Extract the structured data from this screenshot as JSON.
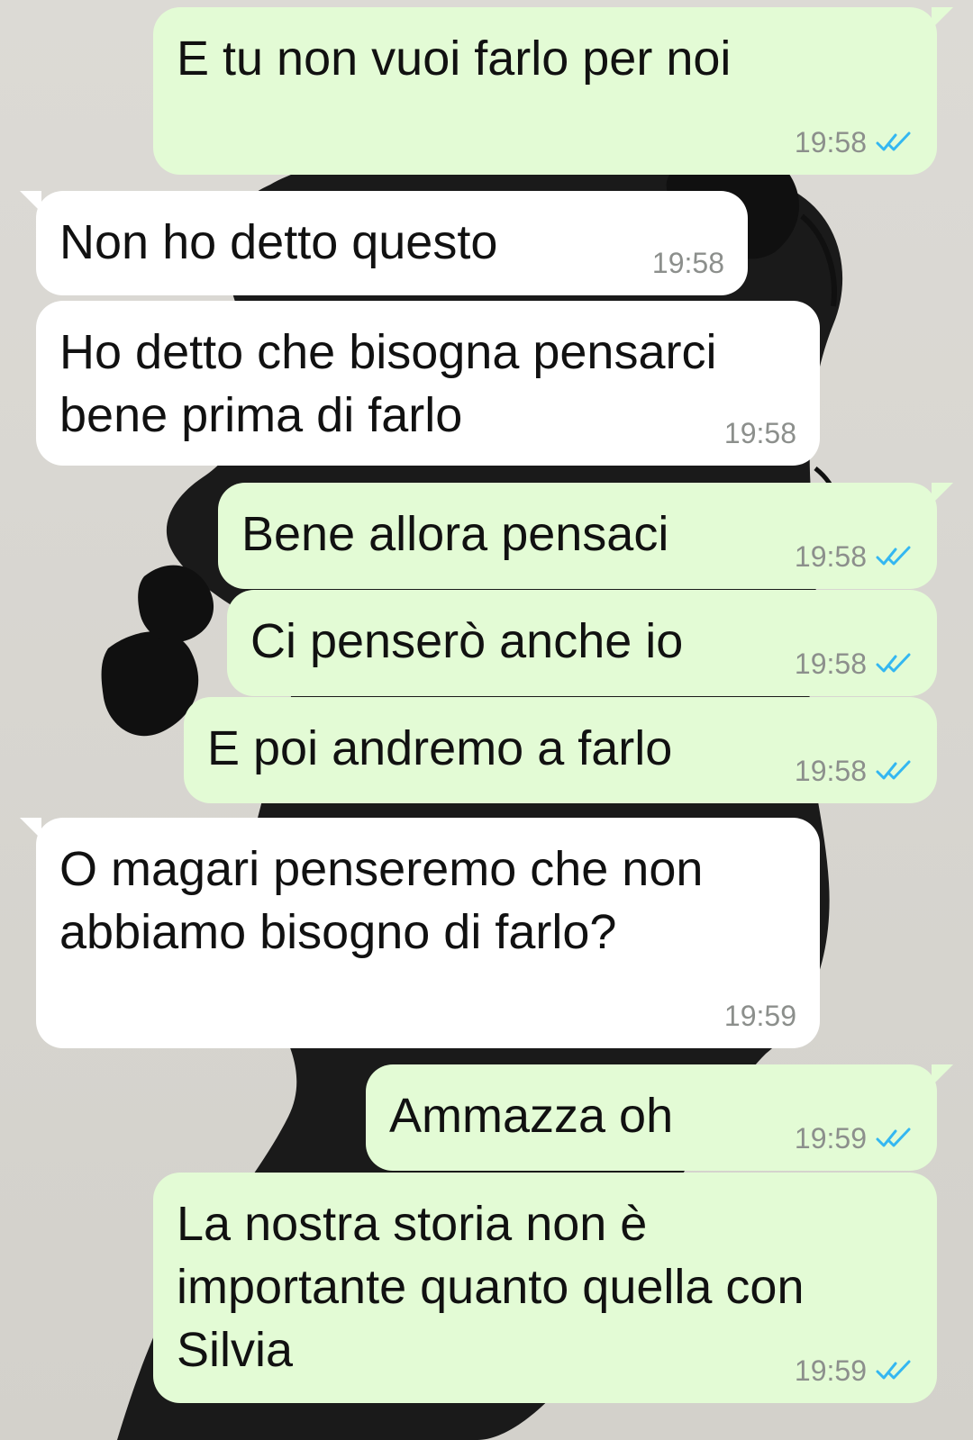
{
  "chat": {
    "messages": [
      {
        "direction": "out",
        "text": "E tu non vuoi farlo per noi",
        "time": "19:58",
        "status_icon": "double-check-icon",
        "status_color": "#34b7f1"
      },
      {
        "direction": "in",
        "text": "Non ho detto questo",
        "time": "19:58"
      },
      {
        "direction": "in",
        "text": "Ho detto che bisogna pensarci\nbene prima di farlo",
        "time": "19:58"
      },
      {
        "direction": "out",
        "text": "Bene allora pensaci",
        "time": "19:58",
        "status_icon": "double-check-icon",
        "status_color": "#34b7f1"
      },
      {
        "direction": "out",
        "text": "Ci penserò anche io",
        "time": "19:58",
        "status_icon": "double-check-icon",
        "status_color": "#34b7f1"
      },
      {
        "direction": "out",
        "text": "E poi andremo a farlo",
        "time": "19:58",
        "status_icon": "double-check-icon",
        "status_color": "#34b7f1"
      },
      {
        "direction": "in",
        "text": "O magari penseremo che non\nabbiamo bisogno di farlo?",
        "time": "19:59"
      },
      {
        "direction": "out",
        "text": "Ammazza oh",
        "time": "19:59",
        "status_icon": "double-check-icon",
        "status_color": "#34b7f1"
      },
      {
        "direction": "out",
        "text": "La nostra storia non è\nimportante quanto quella con\nSilvia",
        "time": "19:59",
        "status_icon": "double-check-icon",
        "status_color": "#34b7f1"
      }
    ]
  },
  "colors": {
    "outgoing_bubble": "#e3fbd5",
    "incoming_bubble": "#ffffff",
    "time_text": "#8c8f8c",
    "read_ticks": "#34b7f1",
    "wallpaper": "#d8d6d1"
  }
}
